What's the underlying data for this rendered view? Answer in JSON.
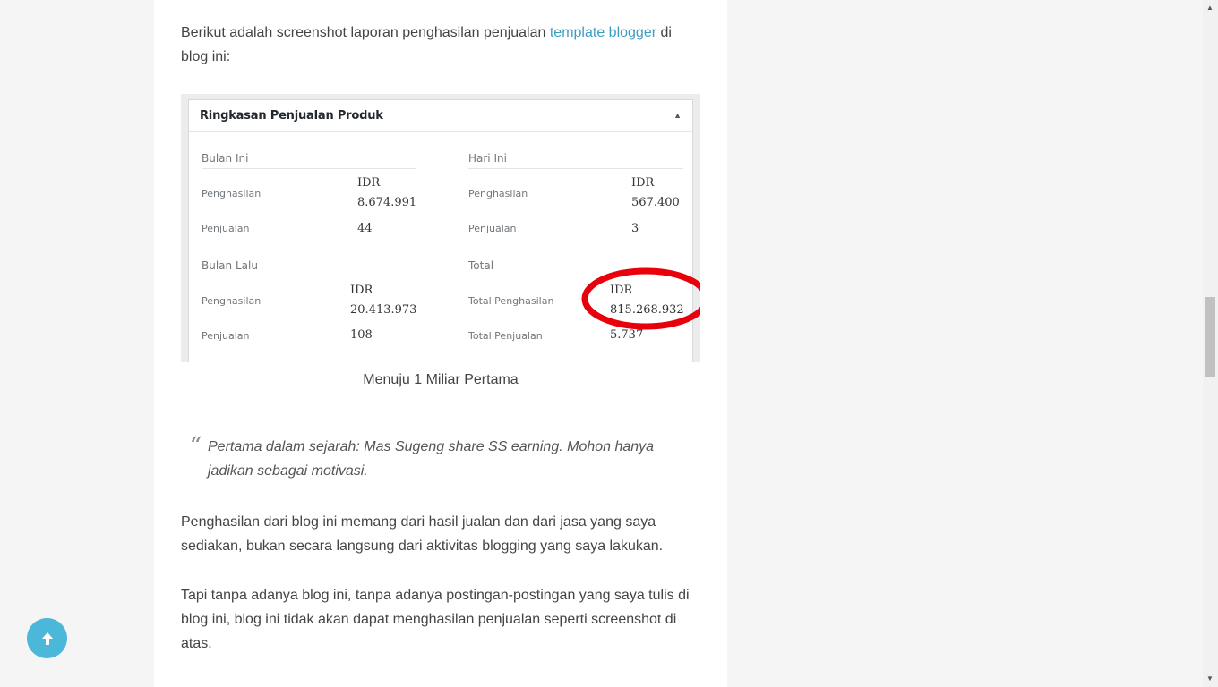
{
  "article": {
    "intro_before_link": "Berikut adalah screenshot laporan penghasilan penjualan ",
    "intro_link": "template blogger",
    "intro_after_link": " di blog ini:",
    "caption": "Menuju 1 Miliar Pertama",
    "quote": "Pertama dalam sejarah: Mas Sugeng share SS earning. Mohon hanya jadikan sebagai motivasi.",
    "para2": "Penghasilan dari blog ini memang dari hasil jualan dan dari jasa yang saya sediakan, bukan secara langsung dari aktivitas blogging yang saya lakukan.",
    "para3": "Tapi tanpa adanya blog ini, tanpa adanya postingan-postingan yang saya tulis di blog ini, blog ini tidak akan dapat menghasilan penjualan seperti screenshot di atas."
  },
  "summary": {
    "title": "Ringkasan Penjualan Produk",
    "toggle_icon": "triangle-up",
    "sections": {
      "bulan_ini": {
        "heading": "Bulan Ini",
        "penghasilan_label": "Penghasilan",
        "penghasilan_currency": "IDR",
        "penghasilan_value": "8.674.991",
        "penjualan_label": "Penjualan",
        "penjualan_value": "44"
      },
      "hari_ini": {
        "heading": "Hari Ini",
        "penghasilan_label": "Penghasilan",
        "penghasilan_currency": "IDR",
        "penghasilan_value": "567.400",
        "penjualan_label": "Penjualan",
        "penjualan_value": "3"
      },
      "bulan_lalu": {
        "heading": "Bulan Lalu",
        "penghasilan_label": "Penghasilan",
        "penghasilan_currency": "IDR",
        "penghasilan_value": "20.413.973",
        "penjualan_label": "Penjualan",
        "penjualan_value": "108"
      },
      "total": {
        "heading": "Total",
        "penghasilan_label": "Total Penghasilan",
        "penghasilan_currency": "IDR",
        "penghasilan_value": "815.268.932",
        "penjualan_label": "Total Penjualan",
        "penjualan_value": "5.737"
      }
    },
    "highlight_color": "#e8000b"
  },
  "ui": {
    "scroll_top_icon": "arrow-up",
    "accent_color": "#4bb8d9",
    "link_color": "#3b9fc1"
  }
}
